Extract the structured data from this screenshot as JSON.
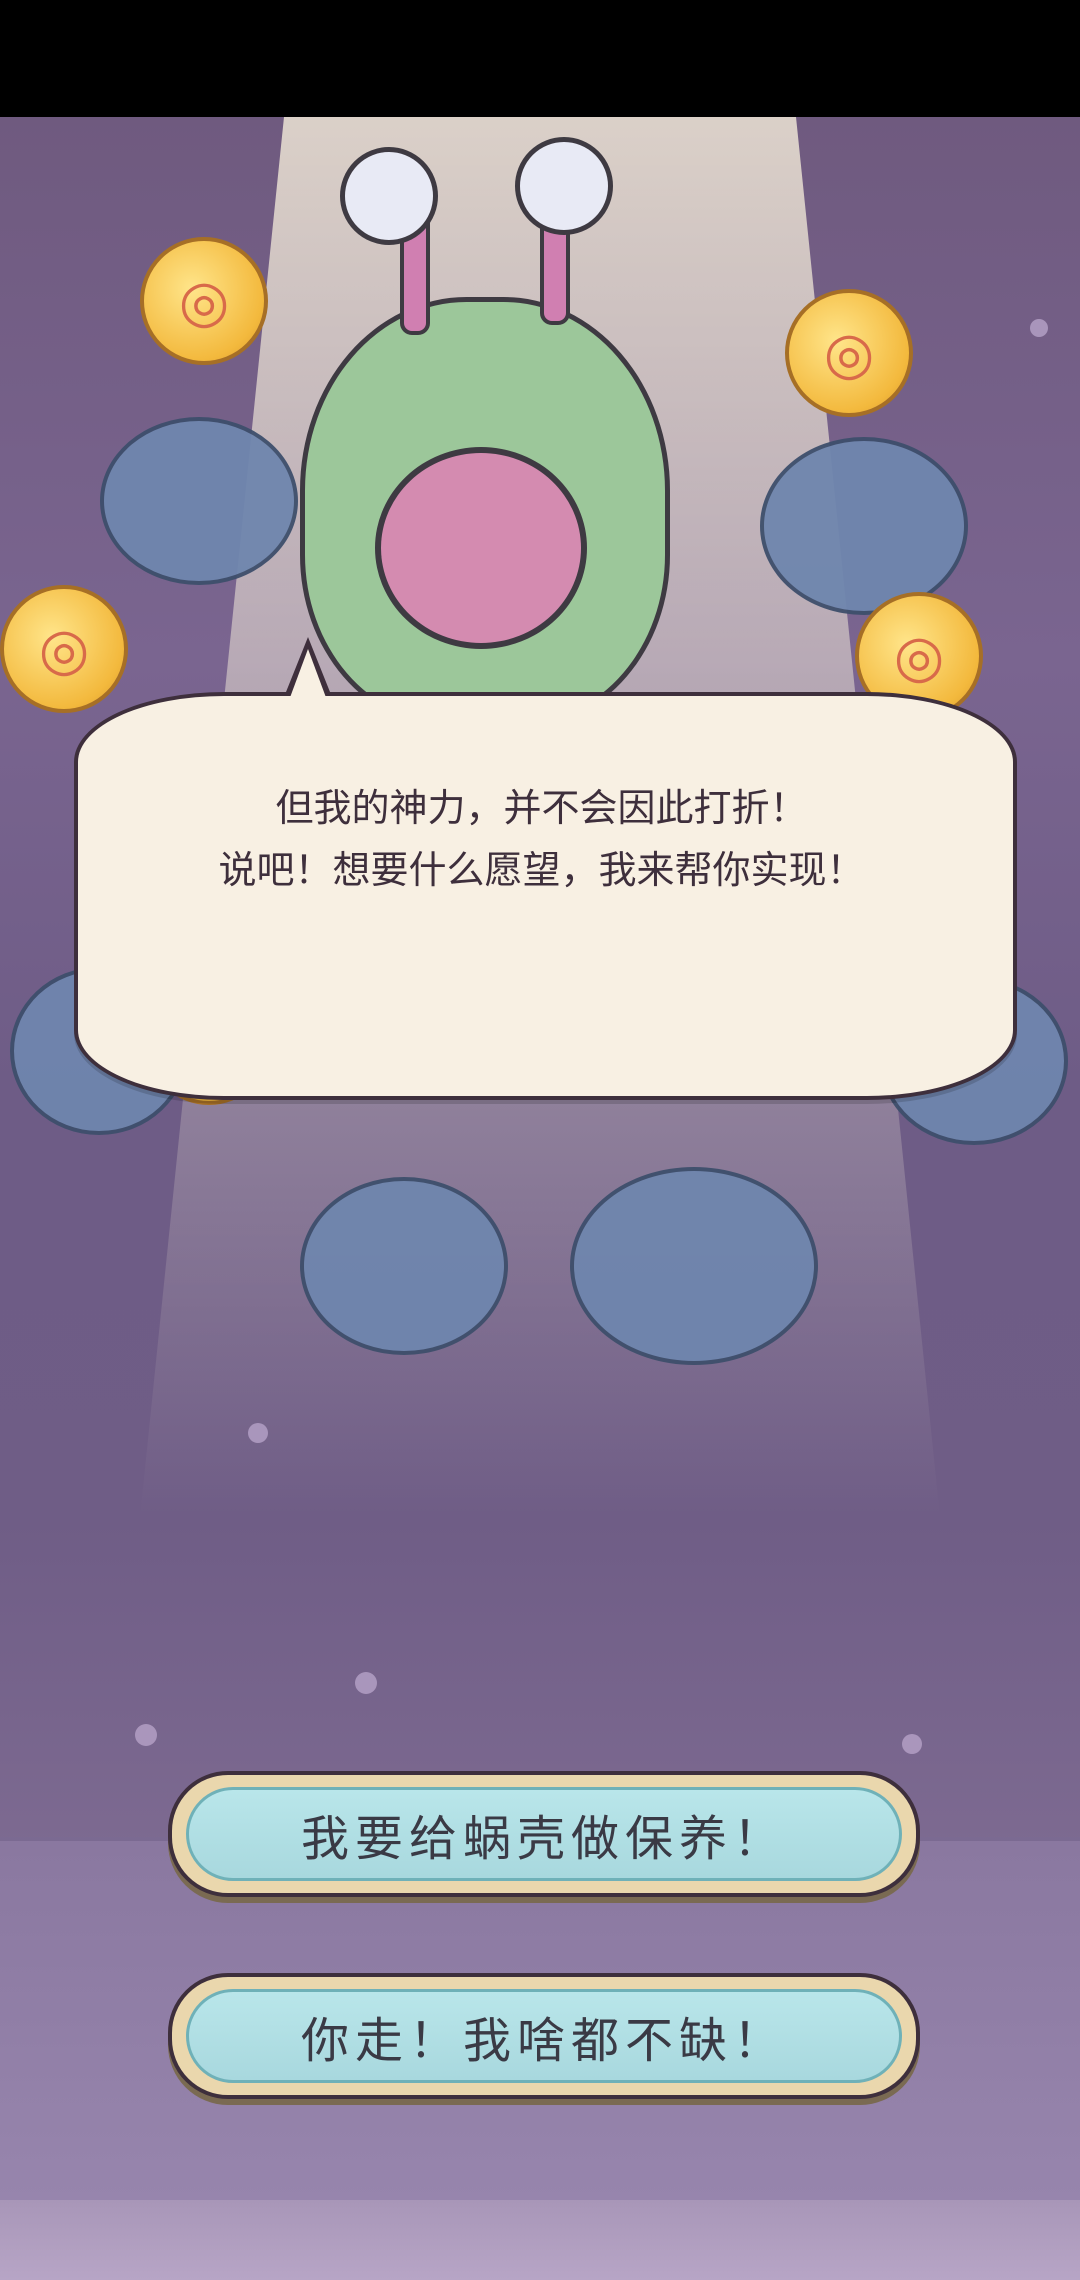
{
  "dialog": {
    "line1": "但我的神力，并不会因此打折！",
    "line2": "说吧！想要什么愿望，我来帮你实现！"
  },
  "choices": [
    {
      "label": "我要给蜗壳做保养！"
    },
    {
      "label": "你走！我啥都不缺！"
    }
  ],
  "colors": {
    "background": "#6f5a7f",
    "bubble": "#f8f0e3",
    "button_face": "#b9e6ea",
    "button_frame": "#ead7ad"
  }
}
